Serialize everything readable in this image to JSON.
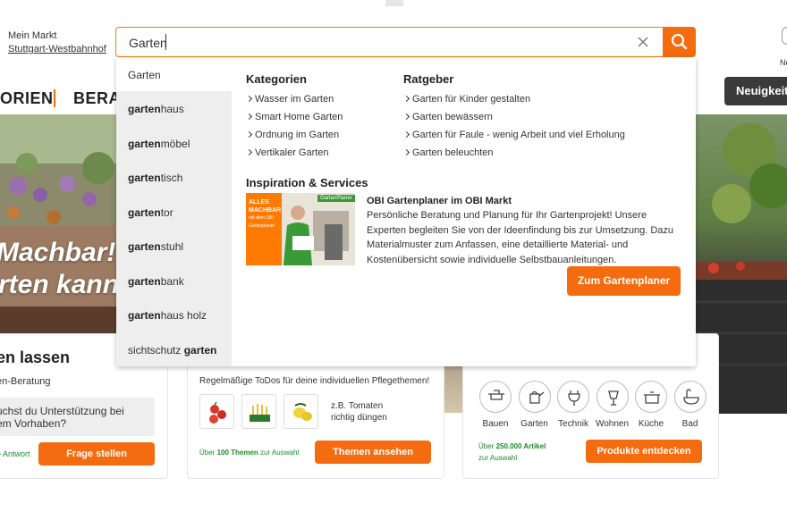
{
  "header": {
    "markt_label": "Mein Markt",
    "markt_name": "Stuttgart-Westbahnhof",
    "search_value": "Garten",
    "right_label": "Ne"
  },
  "nav": {
    "item1": "ORIEN",
    "item2": "BERAT",
    "news_button": "Neuigkeit"
  },
  "hero": {
    "line1": "Machbar!",
    "line2": "rten kann"
  },
  "card1": {
    "title": "en lassen",
    "subtitle": "en-Beratung",
    "question_line1": "uchst du Unterstützung bei",
    "question_line2": "em Vorhaben?",
    "answer_note": "e Antwort",
    "button": "Frage stellen"
  },
  "card2": {
    "subtitle": "Regelmäßige ToDos für deine individuellen Pflegethemen!",
    "example_line1": "z.B. Tomaten",
    "example_line2": "richtig düngen",
    "note_prefix": "Über ",
    "note_bold": "100 Themen",
    "note_suffix": " zur Auswahl",
    "button": "Themen ansehen"
  },
  "card3": {
    "categories": [
      {
        "label": "Bauen",
        "icon": "tools-icon"
      },
      {
        "label": "Garten",
        "icon": "watering-can-icon"
      },
      {
        "label": "Technik",
        "icon": "plug-icon"
      },
      {
        "label": "Wohnen",
        "icon": "lamp-icon"
      },
      {
        "label": "Küche",
        "icon": "pot-icon"
      },
      {
        "label": "Bad",
        "icon": "bathtub-icon"
      }
    ],
    "note_prefix": "Über ",
    "note_bold": "250.000 Artikel",
    "note_suffix": "zur Auswahl",
    "button": "Produkte entdecken"
  },
  "dropdown": {
    "suggestions": [
      {
        "bold": "",
        "rest": "Garten"
      },
      {
        "bold": "garten",
        "rest": "haus"
      },
      {
        "bold": "garten",
        "rest": "möbel"
      },
      {
        "bold": "garten",
        "rest": "tisch"
      },
      {
        "bold": "garten",
        "rest": "tor"
      },
      {
        "bold": "garten",
        "rest": "stuhl"
      },
      {
        "bold": "garten",
        "rest": "bank"
      },
      {
        "bold": "garten",
        "rest": "haus holz"
      },
      {
        "pre": "sichtschutz ",
        "bold": "garten",
        "rest": ""
      }
    ],
    "kategorien_title": "Kategorien",
    "kategorien": [
      "Wasser im Garten",
      "Smart Home Garten",
      "Ordnung im Garten",
      "Vertikaler Garten"
    ],
    "ratgeber_title": "Ratgeber",
    "ratgeber": [
      "Garten für Kinder gestalten",
      "Garten bewässern",
      "Garten für Faule - wenig Arbeit und viel Erholung",
      "Garten beleuchten"
    ],
    "inspiration_title": "Inspiration & Services",
    "promo": {
      "badge_line1": "ALLES",
      "badge_line2": "MACHBAR",
      "badge_line3": "mit dem OBI",
      "badge_line4": "Gartenplaner",
      "tag": "GartenPlaner",
      "title": "OBI Gartenplaner im OBI Markt",
      "lines": [
        "Persönliche Beratung und Planung für Ihr Gartenprojekt! Unsere",
        "Experten begleiten Sie von der Ideenfindung bis zur Umsetzung. Dazu",
        "Materialmuster zum Anfassen, eine detaillierte Material- und",
        "Kostenübersicht sowie individuelle Selbstbauanleitungen."
      ],
      "button": "Zum Gartenplaner"
    }
  },
  "colors": {
    "accent": "#f56b0f",
    "green": "#1d8a2a"
  }
}
